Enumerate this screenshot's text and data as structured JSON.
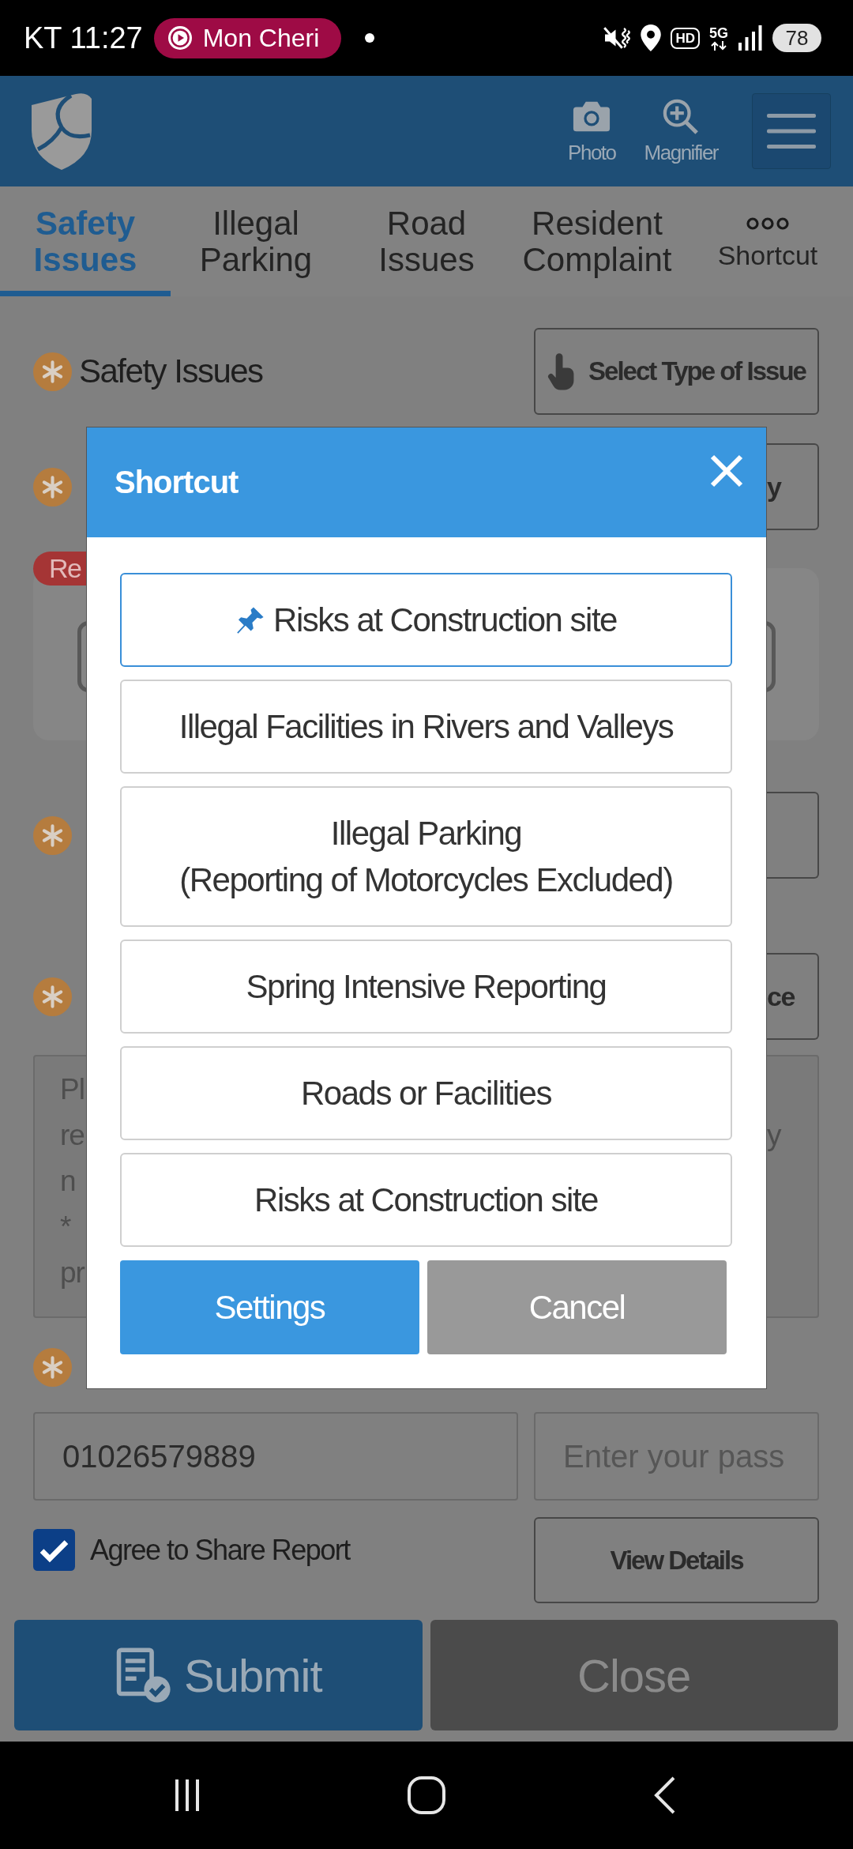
{
  "status_bar": {
    "time": "KT 11:27",
    "media": "Mon Cheri",
    "call_quality": "HD",
    "network": "5G",
    "battery": "78"
  },
  "header": {
    "actions": [
      {
        "kind": "camera",
        "label": "Photo"
      },
      {
        "kind": "magnifier",
        "label": "Magnifier"
      }
    ]
  },
  "tabs": [
    {
      "kind": "text",
      "label": "Safety Issues",
      "selected": true
    },
    {
      "kind": "text",
      "label": "Illegal Parking",
      "selected": false
    },
    {
      "kind": "text",
      "label": "Road Issues",
      "selected": false
    },
    {
      "kind": "text",
      "label": "Resident Complaint",
      "selected": false
    },
    {
      "kind": "more",
      "label": "Shortcut",
      "selected": false
    }
  ],
  "form": {
    "sections": [
      {
        "kind": "field",
        "required": true,
        "label": "Safety Issues",
        "button": {
          "kind": "full",
          "label": "Select Type of Issue"
        }
      },
      {
        "kind": "field",
        "required": true,
        "button": {
          "kind": "stub",
          "label": "y"
        }
      },
      {
        "kind": "card",
        "badge": "Re"
      },
      {
        "kind": "field",
        "required": true,
        "button": {
          "kind": "stub"
        }
      },
      {
        "kind": "field",
        "required": true,
        "button": {
          "kind": "stub",
          "label": "ce"
        }
      },
      {
        "kind": "textarea",
        "lines": [
          {
            "start": "Pl"
          },
          {
            "start": "re",
            "end": "y"
          },
          {
            "start": "n"
          },
          {
            "start": "*"
          },
          {
            "start": "pr"
          }
        ]
      },
      {
        "kind": "field",
        "required": true
      },
      {
        "kind": "inputs",
        "phone": {
          "value": "01026579889"
        },
        "password": {
          "placeholder": "Enter your pass"
        }
      },
      {
        "kind": "consent",
        "label": "Agree to Share Report",
        "checked": true,
        "button": "View Details"
      }
    ]
  },
  "footer": {
    "buttons": [
      {
        "kind": "submit",
        "label": "Submit"
      },
      {
        "kind": "close",
        "label": "Close"
      }
    ]
  },
  "modal": {
    "title": "Shortcut",
    "items": [
      {
        "label": "Risks at Construction site",
        "pinned": true
      },
      {
        "label": "Illegal Facilities in Rivers and Valleys",
        "pinned": false
      },
      {
        "label": "Illegal Parking\n(Reporting of Motorcycles Excluded)",
        "pinned": false
      },
      {
        "label": "Spring Intensive Reporting",
        "pinned": false
      },
      {
        "label": "Roads or Facilities",
        "pinned": false
      },
      {
        "label": "Risks at Construction site",
        "pinned": false
      }
    ],
    "actions": [
      {
        "kind": "primary",
        "label": "Settings"
      },
      {
        "kind": "secondary",
        "label": "Cancel"
      }
    ]
  }
}
